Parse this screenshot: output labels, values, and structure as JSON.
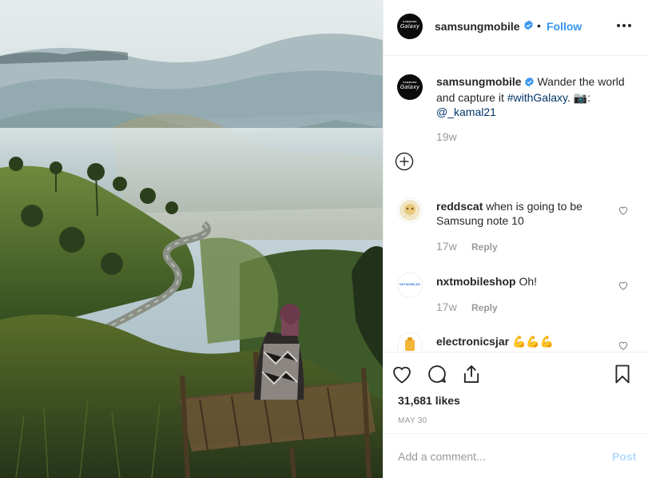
{
  "post": {
    "image_icon": "landscape-photo",
    "author": "samsungmobile",
    "avatar_brand_top": "SAMSUNG",
    "avatar_brand": "Galaxy",
    "follow_label": "Follow",
    "dot": "•",
    "caption": {
      "text_before": "Wander the world and capture it ",
      "hashtag": "#withGalaxy",
      "text_after": ". 📷:",
      "mention": "@_kamal21",
      "time": "19w"
    },
    "comments": [
      {
        "user": "reddscat",
        "text": "when is going to be Samsung note 10",
        "time": "17w",
        "reply_label": "Reply"
      },
      {
        "user": "nxtmobileshop",
        "text": "Oh!",
        "time": "17w",
        "reply_label": "Reply",
        "avatar_text": "NXTMOBILES"
      },
      {
        "user": "electronicsjar",
        "text": "💪💪💪"
      }
    ],
    "likes": "31,681 likes",
    "date": "MAY 30",
    "comment_placeholder": "Add a comment...",
    "post_label": "Post"
  },
  "colors": {
    "link_blue": "#3897f0",
    "hashtag": "#003569",
    "muted": "#999999",
    "post_disabled": "#b3dbff"
  }
}
